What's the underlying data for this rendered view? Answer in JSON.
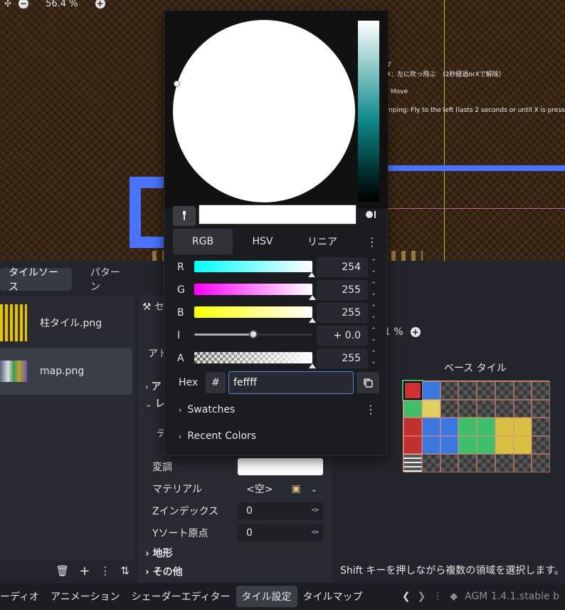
{
  "viewport": {
    "zoom_level": "56.4 %",
    "overlay_lines": [
      "プ",
      "X：左に吹っ飛ぶ　（2秒経過orXで解除）",
      ": Move",
      "mping: Fly to the left (lasts 2 seconds or until X is pressed"
    ]
  },
  "tile_sources": {
    "tabs": [
      "タイルソース",
      "パターン"
    ],
    "active_tab": 0,
    "items": [
      {
        "name": "柱タイル.png",
        "selected": false
      },
      {
        "name": "map.png",
        "selected": true
      }
    ]
  },
  "properties": {
    "title": "セ",
    "subtitle": "アト",
    "collapsed_a": "ア",
    "collapsed_b": "レ",
    "texture_label": "テ",
    "rows": [
      {
        "label": "変調",
        "value": ""
      },
      {
        "label": "マテリアル",
        "value": "<空>"
      },
      {
        "label": "Zインデックス",
        "value": "0"
      },
      {
        "label": "Yソート原点",
        "value": "0"
      }
    ],
    "groups": [
      "地形",
      "その他"
    ]
  },
  "atlas": {
    "zoom_level": "1 %",
    "base_label": "ベース タイル",
    "hint": "Shift キーを押しながら複数の領域を選択します。"
  },
  "bottom_bar": {
    "tabs": [
      "ーディオ",
      "アニメーション",
      "シェーダーエディター",
      "タイル設定",
      "タイルマップ"
    ],
    "active_tab": 3,
    "version": "AGM 1.4.1.stable b"
  },
  "color_picker": {
    "modes": [
      "RGB",
      "HSV",
      "リニア"
    ],
    "active_mode": 0,
    "channels": [
      {
        "label": "R",
        "value": "254",
        "fraction": 0.996
      },
      {
        "label": "G",
        "value": "255",
        "fraction": 1.0
      },
      {
        "label": "B",
        "value": "255",
        "fraction": 1.0
      },
      {
        "label": "I",
        "value": "+ 0.0",
        "fraction": 0.5
      },
      {
        "label": "A",
        "value": "255",
        "fraction": 1.0
      }
    ],
    "hex_label": "Hex",
    "hash": "#",
    "hex_value": "feffff",
    "swatches_label": "Swatches",
    "recent_label": "Recent Colors",
    "current_color": "#feffff"
  }
}
